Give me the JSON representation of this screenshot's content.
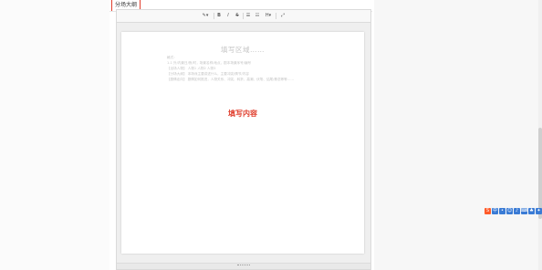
{
  "section": {
    "tab_label": "分场大纲"
  },
  "toolbar": {
    "buttons": [
      {
        "name": "magic-wand",
        "label": "✎▾"
      },
      {
        "name": "bold",
        "label": "B"
      },
      {
        "name": "italic",
        "label": "I"
      },
      {
        "name": "strikethrough",
        "label": "S"
      },
      {
        "name": "ordered-list",
        "label": "☰"
      },
      {
        "name": "unordered-list",
        "label": "☷"
      },
      {
        "name": "font-size",
        "label": "H▾"
      },
      {
        "name": "fullscreen",
        "label": "⤢"
      }
    ]
  },
  "document": {
    "title": "填写区域……",
    "lines": [
      "格式：",
      "1-1 外/内景日/夜/时，场景名称/地点，剧本场景序号/编号",
      "【出场人物】 人物1 人物2 人物3",
      "【分场大纲】 本场戏主要讲述什么，主要冲突/情节/内容",
      "【剧情走向】 剧情如何推进，人物关系、冲突、转折、高潮、伏笔、结尾/悬念等等……"
    ],
    "placeholder": "填写内容"
  },
  "colors": {
    "accent": "#e03e2d"
  }
}
